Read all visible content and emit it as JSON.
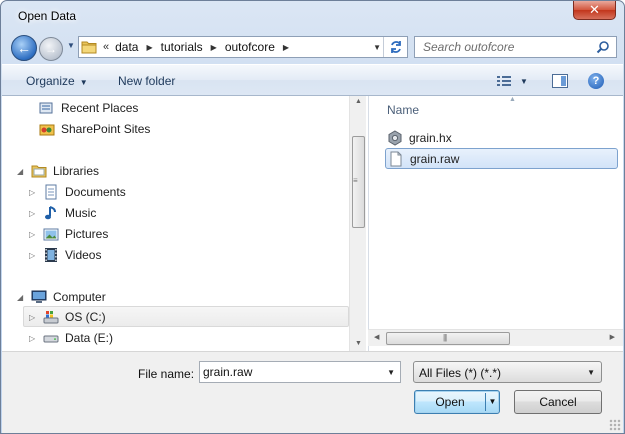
{
  "window": {
    "title": "Open Data",
    "close_glyph": "✕"
  },
  "nav": {
    "back_glyph": "←",
    "forward_glyph": "→"
  },
  "address": {
    "chevrons": "«",
    "crumbs": [
      "data",
      "tutorials",
      "outofcore"
    ]
  },
  "search": {
    "placeholder": "Search outofcore"
  },
  "toolbar": {
    "organize_label": "Organize",
    "new_folder_label": "New folder",
    "help_glyph": "?"
  },
  "navpane": {
    "items": [
      {
        "label": "Recent Places",
        "icon": "recent-places-icon",
        "expander": ""
      },
      {
        "label": "SharePoint Sites",
        "icon": "sharepoint-icon",
        "expander": ""
      },
      {
        "label": "Libraries",
        "icon": "libraries-icon",
        "expander": "◢"
      },
      {
        "label": "Documents",
        "icon": "documents-icon",
        "expander": "▷"
      },
      {
        "label": "Music",
        "icon": "music-icon",
        "expander": "▷"
      },
      {
        "label": "Pictures",
        "icon": "pictures-icon",
        "expander": "▷"
      },
      {
        "label": "Videos",
        "icon": "videos-icon",
        "expander": "▷"
      },
      {
        "label": "Computer",
        "icon": "computer-icon",
        "expander": "◢"
      },
      {
        "label": "OS (C:)",
        "icon": "drive-c-icon",
        "expander": "▷"
      },
      {
        "label": "Data (E:)",
        "icon": "drive-e-icon",
        "expander": "▷"
      }
    ]
  },
  "filepane": {
    "column_name": "Name",
    "files": [
      {
        "name": "grain.hx",
        "icon": "hx-file-icon",
        "selected": false
      },
      {
        "name": "grain.raw",
        "icon": "raw-file-icon",
        "selected": true
      }
    ]
  },
  "bottom": {
    "file_name_label": "File name:",
    "file_name_value": "grain.raw",
    "file_type_value": "All Files (*) (*.*)",
    "open_label": "Open",
    "cancel_label": "Cancel"
  }
}
